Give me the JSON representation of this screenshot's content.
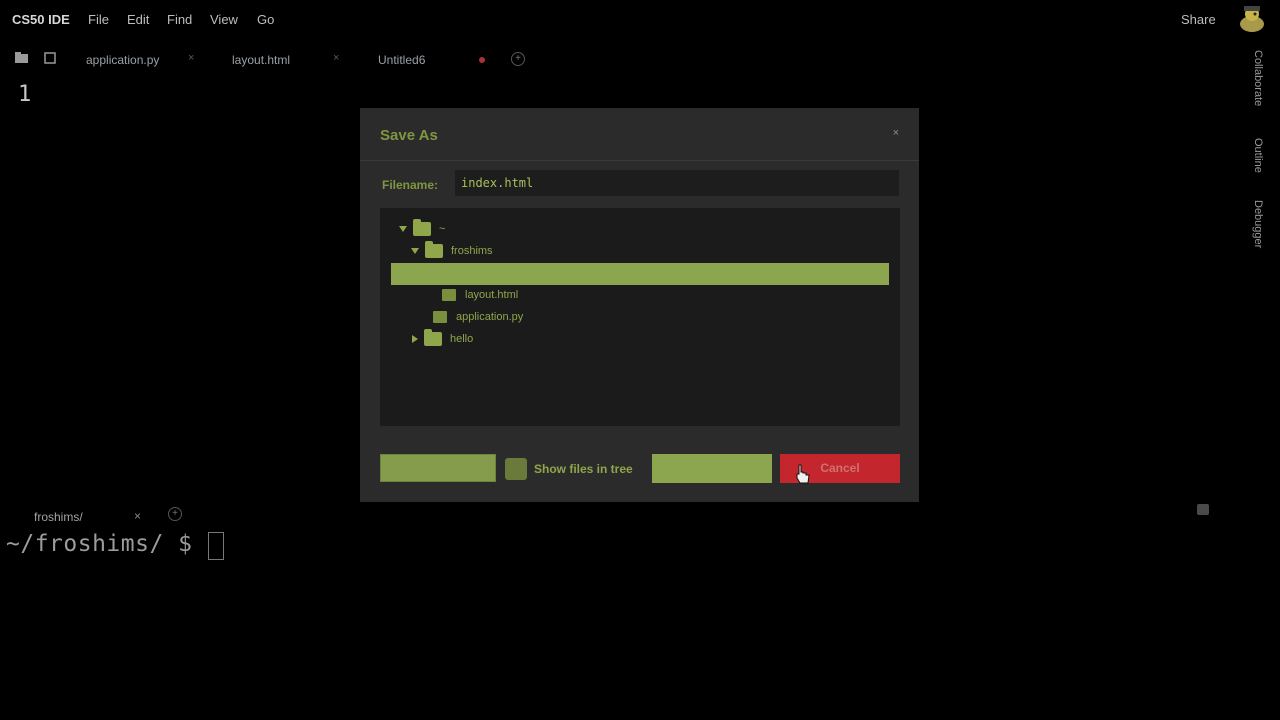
{
  "app": {
    "brand": "CS50 IDE",
    "menus": [
      "File",
      "Edit",
      "Find",
      "View",
      "Go"
    ],
    "share_label": "Share"
  },
  "tabs": [
    {
      "label": "application.py"
    },
    {
      "label": "layout.html"
    },
    {
      "label": "Untitled6"
    }
  ],
  "editor": {
    "line_number": "1"
  },
  "side_panel": [
    "Collaborate",
    "Outline",
    "Debugger"
  ],
  "dialog": {
    "title": "Save As",
    "filename_label": "Filename:",
    "filename_value": "index.html",
    "tree": {
      "root": "~",
      "items": [
        {
          "name": "froshims",
          "type": "folder",
          "expanded": true
        },
        {
          "name": "",
          "type": "folder",
          "selected": true
        },
        {
          "name": "layout.html",
          "type": "file"
        },
        {
          "name": "application.py",
          "type": "file"
        },
        {
          "name": "hello",
          "type": "folder",
          "expanded": false
        }
      ]
    },
    "show_files_label": "Show files in tree",
    "cancel_label": "Cancel",
    "colors": {
      "accent": "#8ba64f",
      "cancel": "#c4262e"
    }
  },
  "terminal": {
    "tab_label": "froshims/",
    "prompt": "~/froshims/ $"
  },
  "icons": {
    "close_tab": "×",
    "close_dialog": "×",
    "plus": "+"
  }
}
